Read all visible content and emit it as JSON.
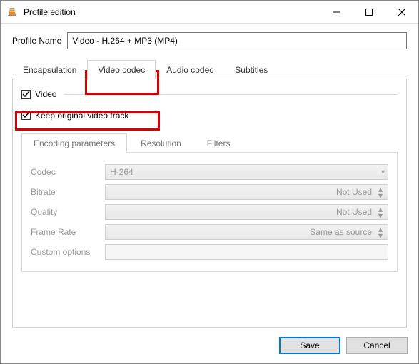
{
  "window": {
    "title": "Profile edition"
  },
  "form": {
    "profileLabel": "Profile Name",
    "profileValue": "Video - H.264 + MP3 (MP4)"
  },
  "tabs": [
    "Encapsulation",
    "Video codec",
    "Audio codec",
    "Subtitles"
  ],
  "videoCheckbox": "Video",
  "keepCheckbox": "Keep original video track",
  "subtabs": [
    "Encoding parameters",
    "Resolution",
    "Filters"
  ],
  "params": {
    "codec": {
      "label": "Codec",
      "value": "H-264"
    },
    "bitrate": {
      "label": "Bitrate",
      "value": "Not Used"
    },
    "quality": {
      "label": "Quality",
      "value": "Not Used"
    },
    "framerate": {
      "label": "Frame Rate",
      "value": "Same as source"
    },
    "custom": {
      "label": "Custom options"
    }
  },
  "buttons": {
    "save": "Save",
    "cancel": "Cancel"
  }
}
